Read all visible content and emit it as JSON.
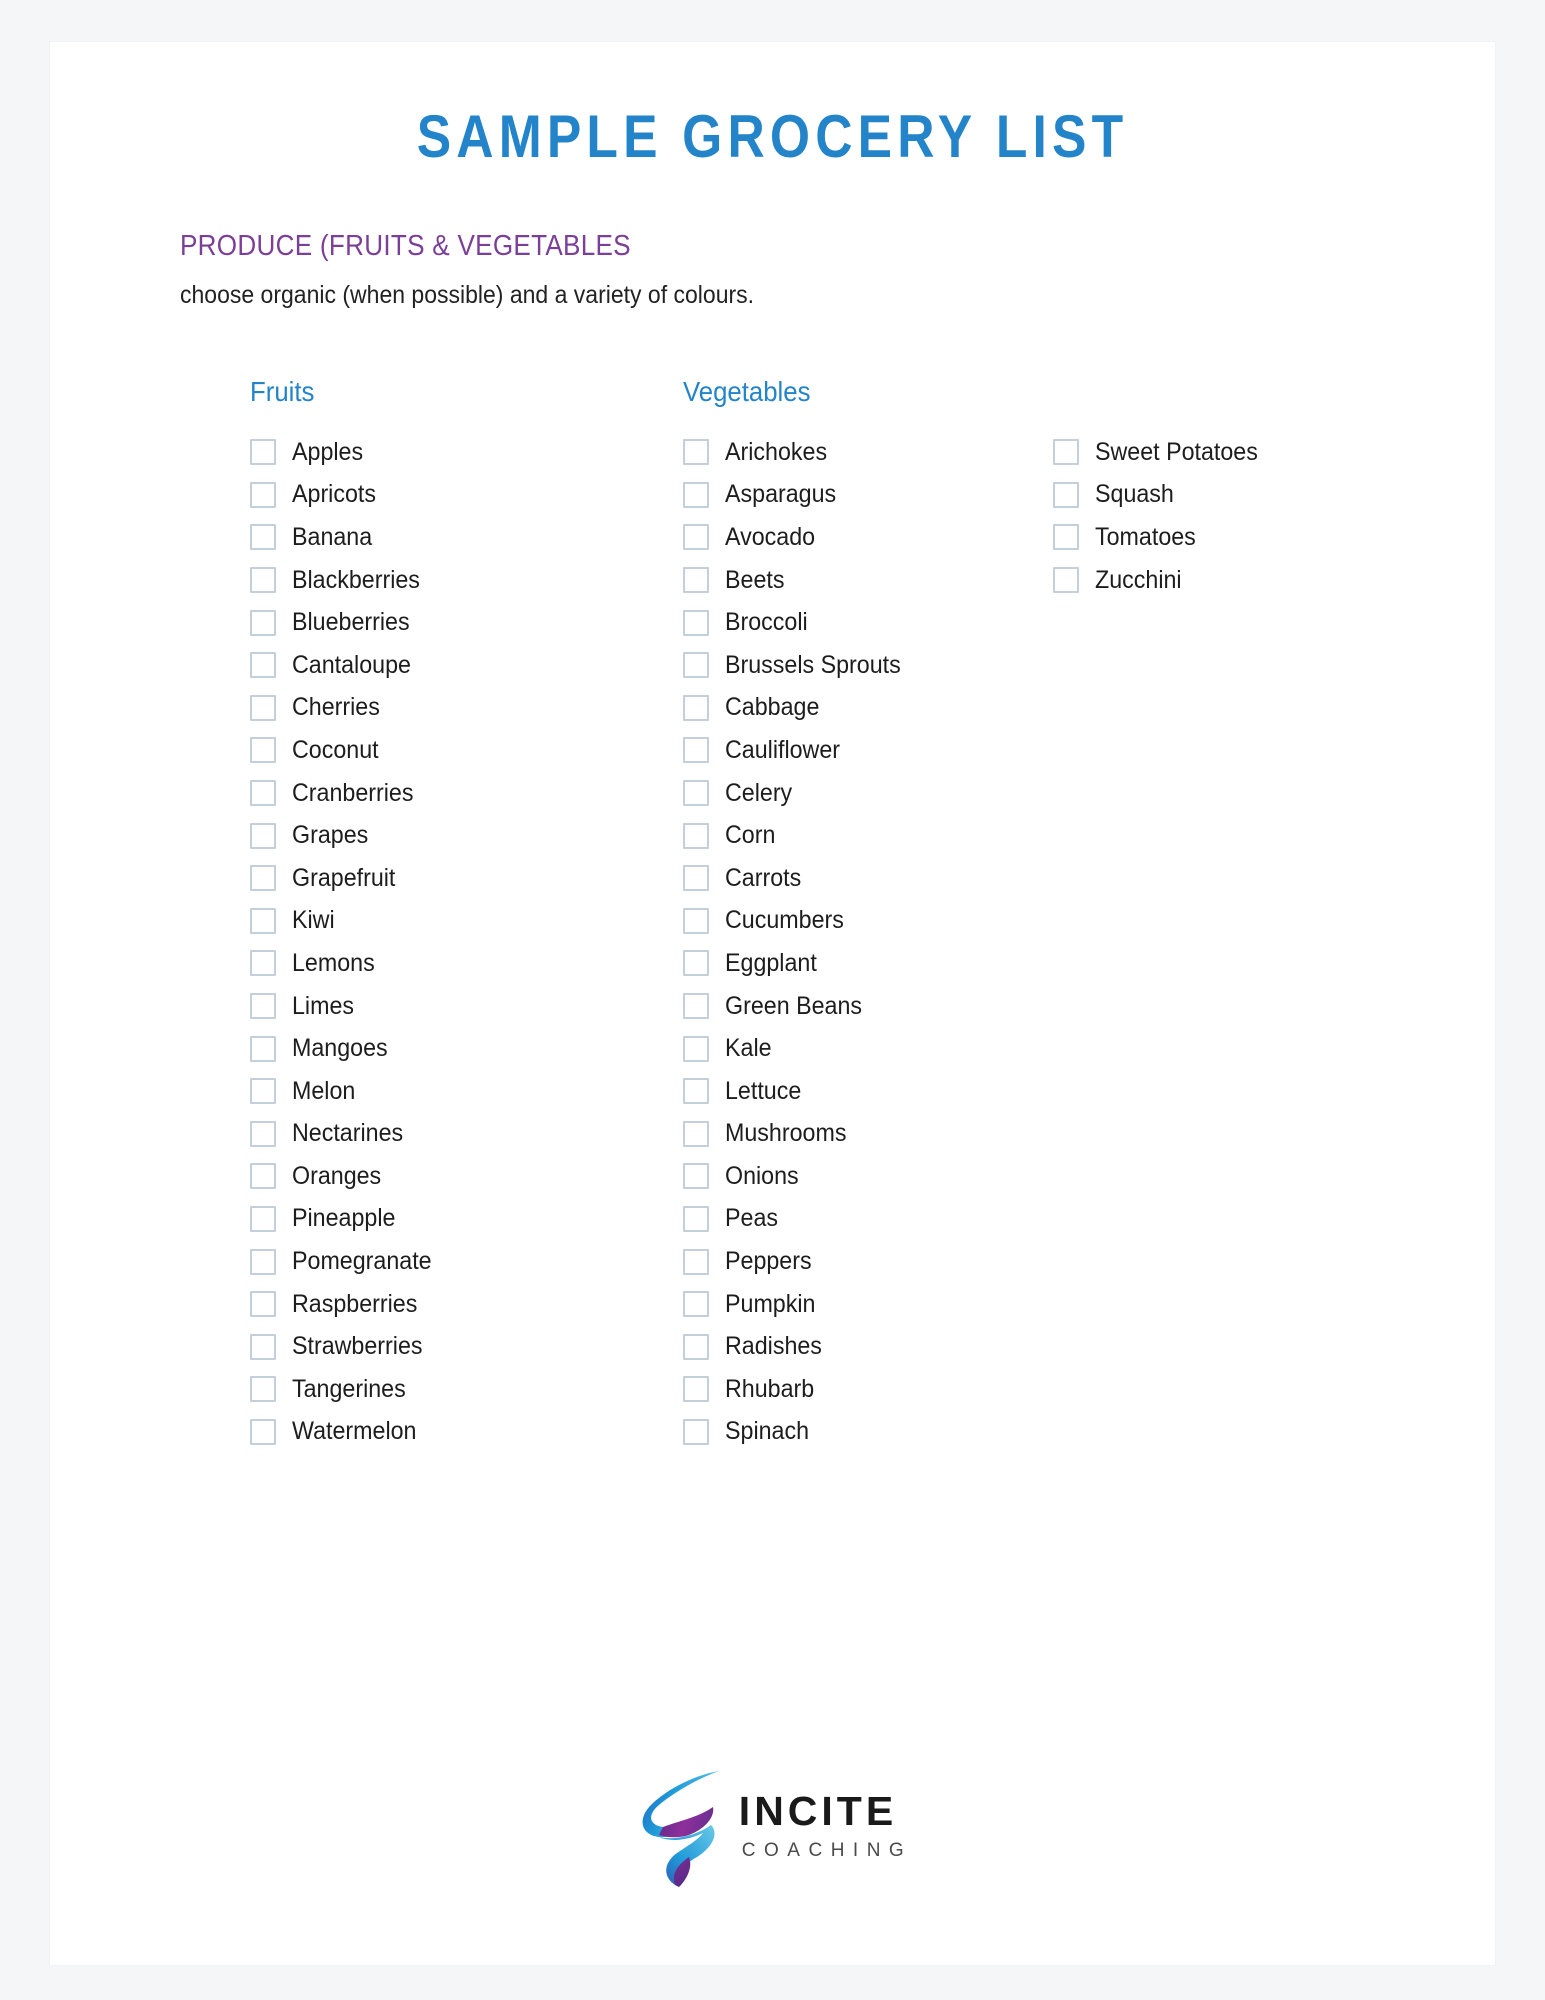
{
  "document": {
    "title": "SAMPLE GROCERY LIST",
    "section_heading": "PRODUCE (FRUITS & VEGETABLES",
    "section_description": "choose organic (when possible) and a variety of colours."
  },
  "colors": {
    "title_blue": "#2384c9",
    "heading_purple": "#7b3f98",
    "column_header_blue": "#2384c9",
    "checkbox_border": "#c3cfda",
    "body_text": "#1d1d1d",
    "page_background": "#f5f6f8",
    "sheet_background": "#ffffff",
    "logo_blue": "#1b9ad6",
    "logo_purple": "#7b2f8f"
  },
  "columns": [
    {
      "header": "Fruits",
      "items": [
        "Apples",
        "Apricots",
        "Banana",
        "Blackberries",
        "Blueberries",
        "Cantaloupe",
        "Cherries",
        "Coconut",
        "Cranberries",
        "Grapes",
        "Grapefruit",
        "Kiwi",
        "Lemons",
        "Limes",
        "Mangoes",
        "Melon",
        "Nectarines",
        "Oranges",
        "Pineapple",
        "Pomegranate",
        "Raspberries",
        "Strawberries",
        "Tangerines",
        "Watermelon"
      ]
    },
    {
      "header": "Vegetables",
      "items": [
        "Arichokes",
        "Asparagus",
        "Avocado",
        "Beets",
        "Broccoli",
        "Brussels Sprouts",
        "Cabbage",
        "Cauliflower",
        "Celery",
        "Corn",
        "Carrots",
        "Cucumbers",
        "Eggplant",
        "Green Beans",
        "Kale",
        "Lettuce",
        "Mushrooms",
        "Onions",
        "Peas",
        "Peppers",
        "Pumpkin",
        "Radishes",
        "Rhubarb",
        "Spinach"
      ]
    },
    {
      "header": "",
      "items": [
        "Sweet Potatoes",
        "Squash",
        "Tomatoes",
        "Zucchini"
      ]
    }
  ],
  "footer": {
    "logo_name": "INCITE",
    "logo_tagline": "COACHING",
    "logo_mark": "incite-swirl-logo"
  }
}
